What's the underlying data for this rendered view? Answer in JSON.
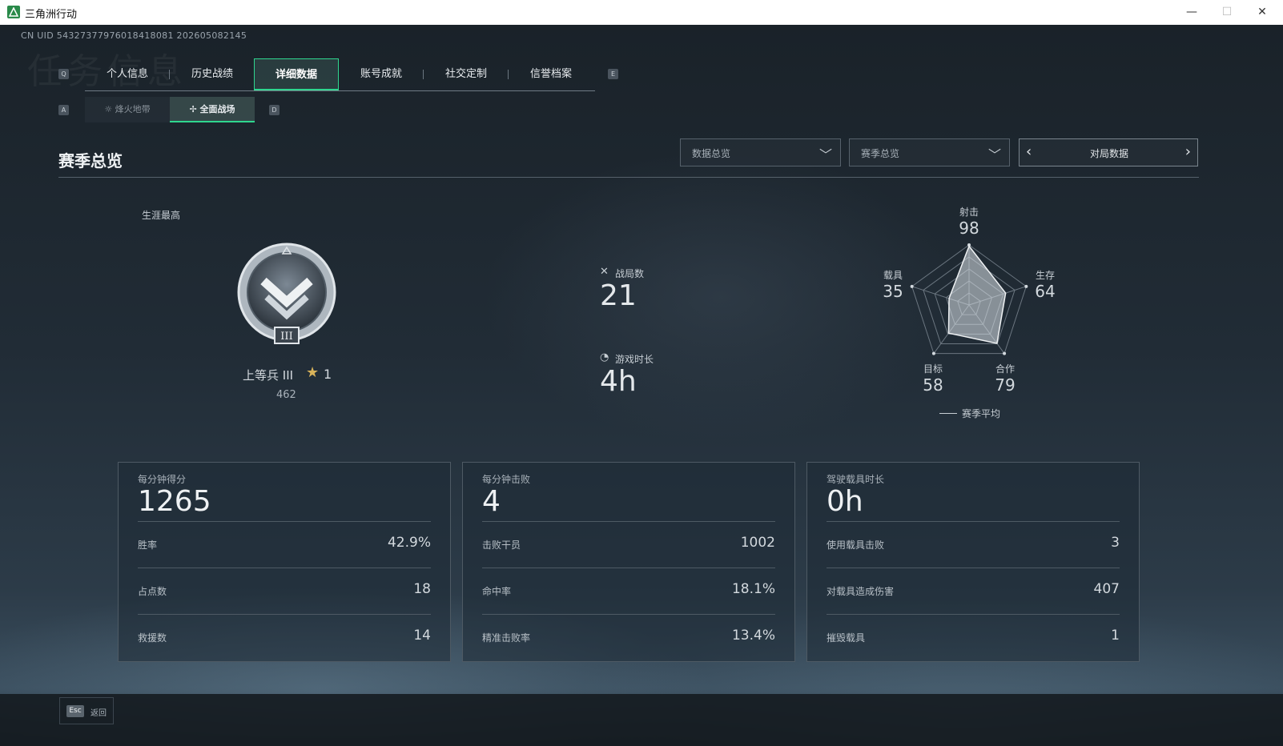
{
  "window": {
    "title": "三角洲行动",
    "min_icon": "minimize-icon",
    "max_icon": "maximize-icon",
    "close_icon": "close-icon"
  },
  "header": {
    "uid": "CN UID 543273779760184180​81 202605082145",
    "ghost_title": "任务信息"
  },
  "tabs": {
    "key_left": "Q",
    "key_right": "E",
    "items": [
      {
        "label": "个人信息"
      },
      {
        "label": "历史战绩"
      },
      {
        "label": "详细数据"
      },
      {
        "label": "账号成就"
      },
      {
        "label": "社交定制"
      },
      {
        "label": "信誉档案"
      }
    ],
    "active_index": 2
  },
  "subtabs": {
    "key_left": "A",
    "key_right": "D",
    "items": [
      {
        "label": "烽火地带"
      },
      {
        "label": "全面战场"
      }
    ],
    "active_index": 1
  },
  "section": {
    "title": "赛季总览"
  },
  "filters": {
    "dropdown1": "数据总览",
    "dropdown2": "赛季总览",
    "pager_label": "对局数据"
  },
  "career": {
    "label": "生涯最高",
    "rank_name": "上等兵 III",
    "stars": "1",
    "points": "462",
    "badge_numeral": "III"
  },
  "mid_stats": {
    "matches_label": "战局数",
    "matches_value": "21",
    "playtime_label": "游戏时长",
    "playtime_value": "4h"
  },
  "radar": {
    "axes": [
      {
        "label": "射击",
        "value": "98"
      },
      {
        "label": "生存",
        "value": "64"
      },
      {
        "label": "合作",
        "value": "79"
      },
      {
        "label": "目标",
        "value": "58"
      },
      {
        "label": "载具",
        "value": "35"
      }
    ],
    "values_numeric": [
      98,
      64,
      79,
      58,
      35
    ],
    "max": 100,
    "legend": "赛季平均"
  },
  "cards": [
    {
      "title": "每分钟得分",
      "big": "1265",
      "rows": [
        {
          "label": "胜率",
          "value": "42.9%"
        },
        {
          "label": "占点数",
          "value": "18"
        },
        {
          "label": "救援数",
          "value": "14"
        }
      ]
    },
    {
      "title": "每分钟击败",
      "big": "4",
      "rows": [
        {
          "label": "击败干员",
          "value": "1002"
        },
        {
          "label": "命中率",
          "value": "18.1%"
        },
        {
          "label": "精准击败率",
          "value": "13.4%"
        }
      ]
    },
    {
      "title": "驾驶载具时长",
      "big": "0h",
      "rows": [
        {
          "label": "使用载具击败",
          "value": "3"
        },
        {
          "label": "对载具造成伤害",
          "value": "407"
        },
        {
          "label": "摧毁载具",
          "value": "1"
        }
      ]
    }
  ],
  "footer": {
    "esc_key": "Esc",
    "esc_label": "返回"
  }
}
